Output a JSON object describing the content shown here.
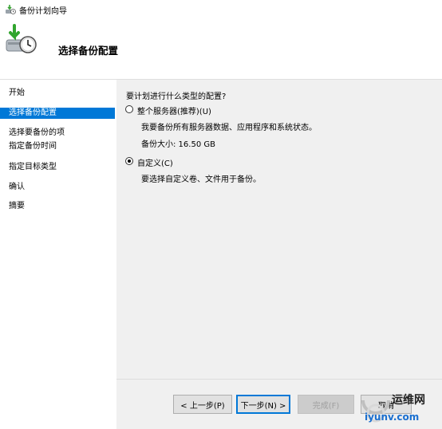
{
  "window": {
    "title": "备份计划向导",
    "icon": "backup-wizard-icon"
  },
  "header": {
    "title": "选择备份配置",
    "icon": "backup-clock-icon"
  },
  "sidebar": {
    "items": [
      {
        "label": "开始",
        "selected": false
      },
      {
        "label": "选择备份配置",
        "selected": true
      },
      {
        "label": "选择要备份的项",
        "selected": false
      },
      {
        "label": "指定备份时间",
        "selected": false
      },
      {
        "label": "指定目标类型",
        "selected": false
      },
      {
        "label": "确认",
        "selected": false
      },
      {
        "label": "摘要",
        "selected": false
      }
    ]
  },
  "main": {
    "question": "要计划进行什么类型的配置?",
    "options": [
      {
        "label": "整个服务器(推荐)(U)",
        "description": "我要备份所有服务器数据、应用程序和系统状态。",
        "size_text": "备份大小: 16.50 GB",
        "checked": false
      },
      {
        "label": "自定义(C)",
        "description": "要选择自定义卷、文件用于备份。",
        "checked": true
      }
    ]
  },
  "footer": {
    "prev_label": "< 上一步(P)",
    "next_label": "下一步(N) >",
    "finish_label": "完成(F)",
    "cancel_label": "取消"
  },
  "watermark": {
    "text1": "运维网",
    "text2": "iyunv.com"
  },
  "colors": {
    "selection": "#0078d7",
    "content_bg": "#f0f0f0"
  }
}
